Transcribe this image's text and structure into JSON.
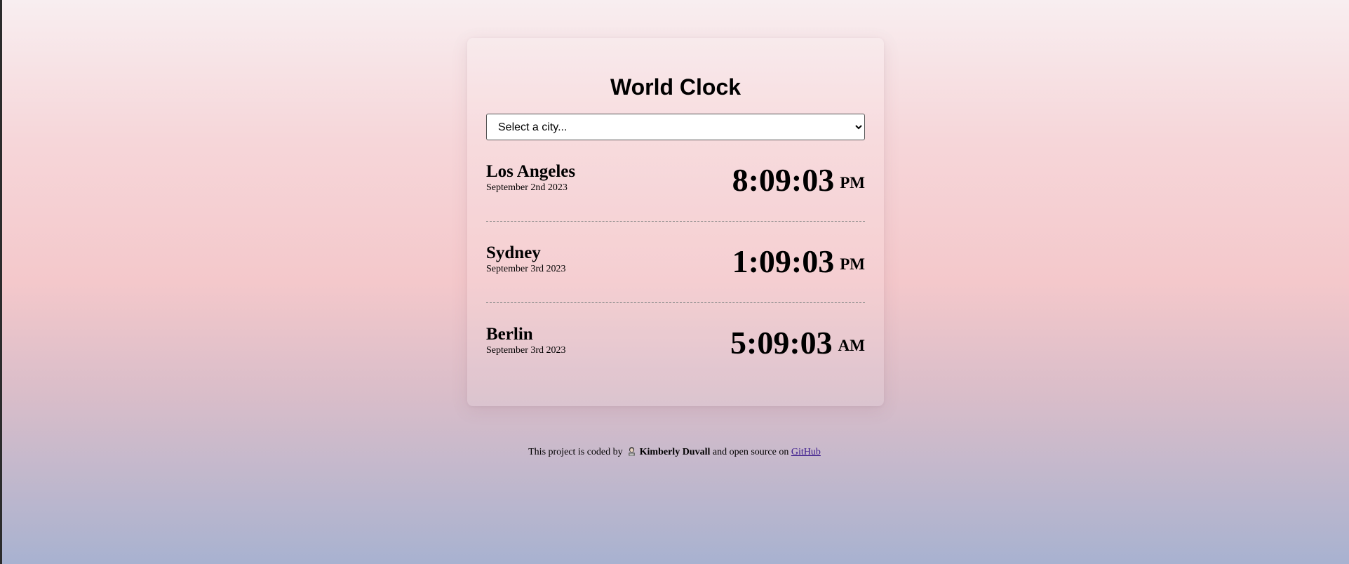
{
  "app": {
    "title": "World Clock"
  },
  "city_select": {
    "selected": "Select a city...",
    "options": [
      "Select a city..."
    ]
  },
  "cities": [
    {
      "name": "Los Angeles",
      "date": "September 2nd 2023",
      "time": "8:09:03",
      "ampm": "PM"
    },
    {
      "name": "Sydney",
      "date": "September 3rd 2023",
      "time": "1:09:03",
      "ampm": "PM"
    },
    {
      "name": "Berlin",
      "date": "September 3rd 2023",
      "time": "5:09:03",
      "ampm": "AM"
    }
  ],
  "footer": {
    "prefix": "This project is coded by",
    "author_icon": "woman-technologist-icon",
    "author": "Kimberly Duvall",
    "middle": "and open source on",
    "link_label": "GitHub"
  },
  "colors": {
    "background_top": "#f8eef0",
    "background_mid": "#f4c8cb",
    "background_bottom": "#a8b2d0",
    "link": "#3b1a8c"
  }
}
